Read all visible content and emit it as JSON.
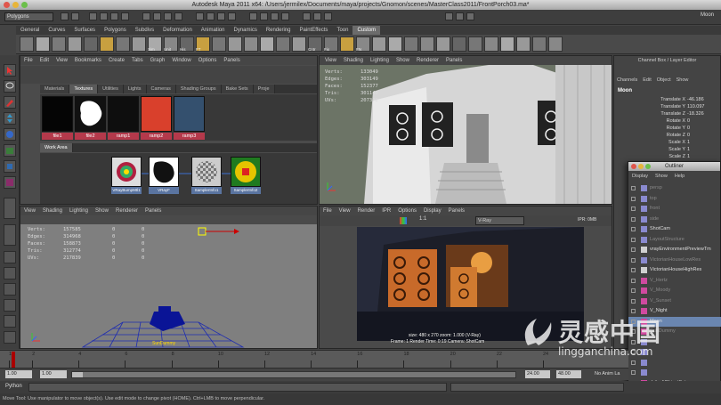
{
  "window": {
    "title": "Autodesk Maya 2011 x64: /Users/jermilex/Documents/maya/projects/Gnomon/scenes/MasterClass2011/FrontPorch03.ma*"
  },
  "status_line": {
    "menu_set": "Polygons",
    "right_label": "Moon"
  },
  "shelf_tabs": [
    "General",
    "Curves",
    "Surfaces",
    "Polygons",
    "Subdivs",
    "Deformation",
    "Animation",
    "Dynamics",
    "Rendering",
    "PaintEffects",
    "Toon",
    "Custom"
  ],
  "shelf_active": "Custom",
  "shelf_labels": [
    "Sim",
    "Unit",
    "His",
    "FT",
    "Cntr",
    "Fix",
    "FN"
  ],
  "hypershade": {
    "menu": [
      "File",
      "Edit",
      "View",
      "Bookmarks",
      "Create",
      "Tabs",
      "Graph",
      "Window",
      "Options",
      "Panels"
    ],
    "tabs": [
      "Materials",
      "Textures",
      "Utilities",
      "Lights",
      "Cameras",
      "Shading Groups",
      "Bake Sets",
      "Proje"
    ],
    "active_tab": "Textures",
    "swatches": [
      {
        "label": "file1",
        "color": "#050505"
      },
      {
        "label": "file2",
        "color": "#ffffff"
      },
      {
        "label": "ramp1",
        "color": "#0e0e0e"
      },
      {
        "label": "ramp2",
        "color": "#d9402c"
      },
      {
        "label": "ramp3",
        "color": "#34506e"
      }
    ],
    "work_area_label": "Work Area",
    "nodes": [
      "VRayBumpMtl1",
      "VRayF",
      "SamplerInfo1",
      "SamplerInfo2"
    ]
  },
  "viewport_top": {
    "menu": [
      "View",
      "Shading",
      "Lighting",
      "Show",
      "Renderer",
      "Panels"
    ],
    "hud": [
      {
        "label": "Verts:",
        "value": "133049"
      },
      {
        "label": "Edges:",
        "value": "303149"
      },
      {
        "label": "Faces:",
        "value": "152377"
      },
      {
        "label": "Tris:",
        "value": "301149"
      },
      {
        "label": "UVs:",
        "value": "207372"
      }
    ]
  },
  "viewport_bottom": {
    "menu": [
      "View",
      "Shading",
      "Lighting",
      "Show",
      "Renderer",
      "Panels"
    ],
    "hud": [
      {
        "label": "Verts:",
        "value": "157585",
        "a": "0",
        "b": "0"
      },
      {
        "label": "Edges:",
        "value": "314968",
        "a": "0",
        "b": "0"
      },
      {
        "label": "Faces:",
        "value": "158873",
        "a": "0",
        "b": "0"
      },
      {
        "label": "Tris:",
        "value": "312774",
        "a": "0",
        "b": "0"
      },
      {
        "label": "UVs:",
        "value": "217839",
        "a": "0",
        "b": "0"
      }
    ],
    "object_label": "SunDummy"
  },
  "render_view": {
    "menu": [
      "File",
      "View",
      "Render",
      "IPR",
      "Options",
      "Display",
      "Panels"
    ],
    "renderer": "V-Ray",
    "ratio": "1:1",
    "ipr_label": "IPR: 0MB",
    "info_line1": "size: 480 x 270 zoom: 1.000     (V-Ray)",
    "info_line2": "Frame: 1      Render Time: 0:19      Camera: ShotCam"
  },
  "channel_box": {
    "title": "Channel Box / Layer Editor",
    "menu": [
      "Channels",
      "Edit",
      "Object",
      "Show"
    ],
    "object": "Moon",
    "attrs": [
      {
        "name": "Translate X",
        "value": "-46.186"
      },
      {
        "name": "Translate Y",
        "value": "110.097"
      },
      {
        "name": "Translate Z",
        "value": "-18.326"
      },
      {
        "name": "Rotate X",
        "value": "0"
      },
      {
        "name": "Rotate Y",
        "value": "0"
      },
      {
        "name": "Rotate Z",
        "value": "0"
      },
      {
        "name": "Scale X",
        "value": "1"
      },
      {
        "name": "Scale Y",
        "value": "1"
      },
      {
        "name": "Scale Z",
        "value": "1"
      }
    ]
  },
  "outliner": {
    "title": "Outliner",
    "menu": [
      "Display",
      "Show",
      "Help"
    ],
    "items": [
      {
        "label": "persp",
        "faded": true
      },
      {
        "label": "top",
        "faded": true
      },
      {
        "label": "front",
        "faded": true
      },
      {
        "label": "side",
        "faded": true
      },
      {
        "label": "ShotCam",
        "faded": false
      },
      {
        "label": "LayoutStructure",
        "faded": true
      },
      {
        "label": "vrayEnvironmentPreviewTm",
        "faded": false
      },
      {
        "label": "VictorianHouseLowRes",
        "faded": true
      },
      {
        "label": "VictorianHouseHighRes",
        "faded": false
      },
      {
        "label": "V_Hertz",
        "faded": true
      },
      {
        "label": "V_Moody",
        "faded": true
      },
      {
        "label": "V_Sunset",
        "faded": true
      },
      {
        "label": "V_Night",
        "faded": false
      },
      {
        "label": "Moon",
        "faded": false,
        "selected": true
      },
      {
        "label": "SunDummy",
        "faded": true
      },
      {
        "label": "",
        "faded": true
      },
      {
        "label": "",
        "faded": true
      },
      {
        "label": "",
        "faded": true
      },
      {
        "label": "",
        "faded": true
      },
      {
        "label": "defaultObjectSet",
        "faded": false
      }
    ]
  },
  "timeline": {
    "ticks": [
      "1",
      "2",
      "4",
      "6",
      "8",
      "10",
      "12",
      "14",
      "16",
      "18",
      "20",
      "22",
      "24"
    ],
    "range": {
      "start": "1.00",
      "inner_start": "1.00",
      "inner_end": "24.00",
      "end": "48.00",
      "anim_layer": "No Anim La"
    }
  },
  "command_line": {
    "label": "Python"
  },
  "help_line": {
    "text": "Move Tool: Use manipulator to move object(s). Use edit mode to change pivot (HOME). Ctrl+LMB to move perpendicular."
  },
  "watermark": {
    "brand": "灵感中国",
    "url": "lingganchina.com"
  }
}
